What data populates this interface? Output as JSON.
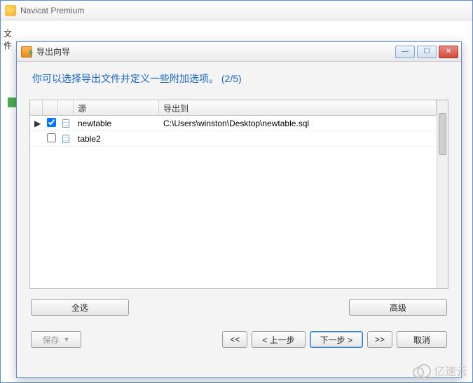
{
  "outer": {
    "app_title": "Navicat Premium",
    "menu_file": "文件"
  },
  "dialog": {
    "title": "导出向导",
    "instruction": "你可以选择导出文件并定义一些附加选项。 (2/5)",
    "columns": {
      "source": "源",
      "dest": "导出到"
    },
    "rows": [
      {
        "checked": true,
        "name": "newtable",
        "dest": "C:\\Users\\winston\\Desktop\\newtable.sql",
        "current": true
      },
      {
        "checked": false,
        "name": "table2",
        "dest": "",
        "current": false
      }
    ],
    "buttons": {
      "select_all": "全选",
      "advanced": "高级",
      "save": "保存",
      "first": "<<",
      "prev": "< 上一步",
      "next": "下一步 >",
      "last": ">>",
      "cancel": "取消"
    }
  },
  "watermark": "亿速云"
}
